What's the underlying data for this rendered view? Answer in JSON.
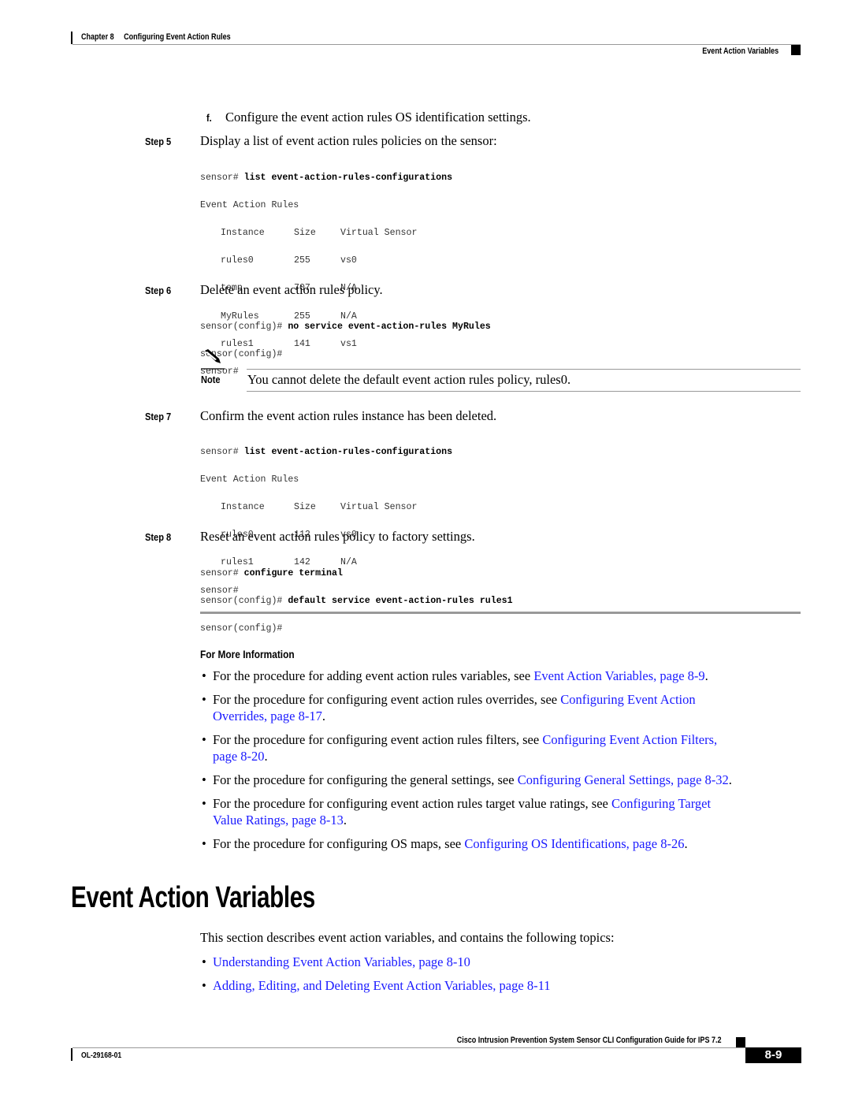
{
  "header": {
    "chapter": "Chapter 8",
    "chapter_title": "Configuring Event Action Rules",
    "section": "Event Action Variables"
  },
  "substep_f": {
    "label": "f.",
    "text": "Configure the event action rules OS identification settings."
  },
  "steps": [
    {
      "label": "Step 5",
      "text": "Display a list of event action rules policies on the sensor:",
      "code": {
        "prompt": "sensor# ",
        "command": "list event-action-rules-configurations",
        "output_title": "Event Action Rules",
        "columns": [
          "Instance",
          "Size",
          "Virtual Sensor"
        ],
        "rows": [
          [
            "rules0",
            "255",
            "vs0"
          ],
          [
            "temp",
            "707",
            "N/A"
          ],
          [
            "MyRules",
            "255",
            "N/A"
          ],
          [
            "rules1",
            "141",
            "vs1"
          ]
        ],
        "end_prompt": "sensor#"
      }
    },
    {
      "label": "Step 6",
      "text": "Delete an event action rules policy.",
      "code": {
        "prompt": "sensor(config)# ",
        "command": "no service event-action-rules MyRules",
        "end_prompt": "sensor(config)#"
      }
    },
    {
      "label": "Step 7",
      "text": "Confirm the event action rules instance has been deleted.",
      "code": {
        "prompt": "sensor# ",
        "command": "list event-action-rules-configurations",
        "output_title": "Event Action Rules",
        "columns": [
          "Instance",
          "Size",
          "Virtual Sensor"
        ],
        "rows": [
          [
            "rules0",
            "112",
            "vs0"
          ],
          [
            "rules1",
            "142",
            "N/A"
          ]
        ],
        "end_prompt": "sensor#"
      }
    },
    {
      "label": "Step 8",
      "text": "Reset an event action rules policy to factory settings.",
      "code": {
        "line1_prompt": "sensor# ",
        "line1_command": "configure terminal",
        "line2_prompt": "sensor(config)# ",
        "line2_command": "default service event-action-rules rules1",
        "end_prompt": "sensor(config)#"
      }
    }
  ],
  "note": {
    "icon": "pencil-icon",
    "label": "Note",
    "text": "You cannot delete the default event action rules policy, rules0."
  },
  "more_info": {
    "heading": "For More Information",
    "items": [
      {
        "text": "For the procedure for adding event action rules variables, see ",
        "link": "Event Action Variables, page 8-9",
        "after": "."
      },
      {
        "text": "For the procedure for configuring event action rules overrides, see ",
        "link_line1": "Configuring Event Action",
        "link_line2": "Overrides, page 8-17",
        "after": "."
      },
      {
        "text": "For the procedure for configuring event action rules filters, see ",
        "link_line1": "Configuring Event Action Filters,",
        "link_line2": "page 8-20",
        "after": "."
      },
      {
        "text": "For the procedure for configuring the general settings, see ",
        "link": "Configuring General Settings, page 8-32",
        "after": "."
      },
      {
        "text": "For the procedure for configuring event action rules target value ratings, see ",
        "link_line1": "Configuring Target",
        "link_line2": "Value Ratings, page 8-13",
        "after": "."
      },
      {
        "text": "For the procedure for configuring OS maps, see ",
        "link": "Configuring OS Identifications, page 8-26",
        "after": "."
      }
    ]
  },
  "section": {
    "title": "Event Action Variables",
    "intro": "This section describes event action variables, and contains the following topics:",
    "topics": [
      "Understanding Event Action Variables, page 8-10",
      "Adding, Editing, and Deleting Event Action Variables, page 8-11"
    ]
  },
  "footer": {
    "guide_title": "Cisco Intrusion Prevention System Sensor CLI Configuration Guide for IPS 7.2",
    "doc_id": "OL-29168-01",
    "page_number": "8-9"
  },
  "colors": {
    "link": "#1a1aff",
    "rule": "#999999",
    "text": "#000000"
  }
}
